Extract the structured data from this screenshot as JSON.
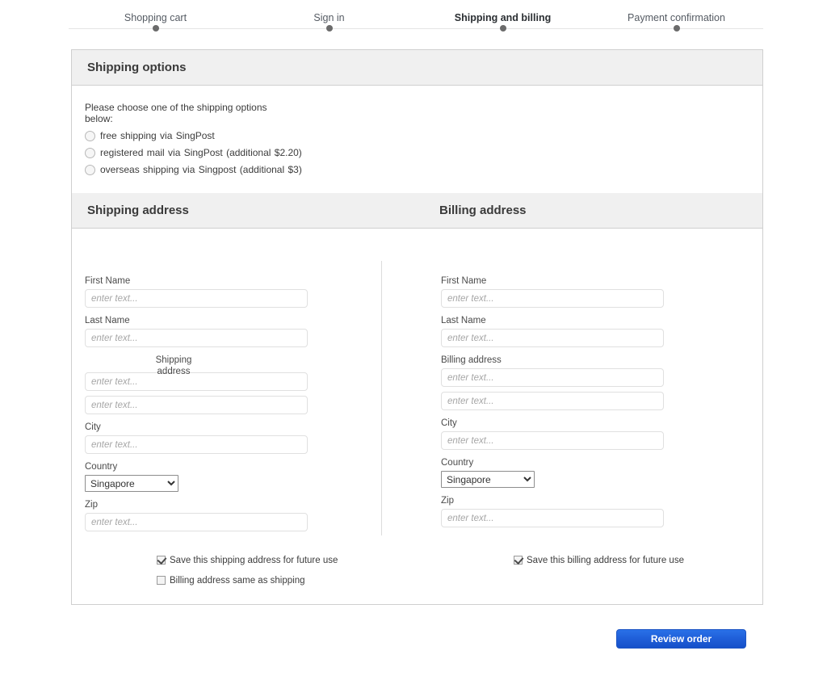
{
  "steps": {
    "items": [
      {
        "label": "Shopping cart",
        "active": false
      },
      {
        "label": "Sign in",
        "active": false
      },
      {
        "label": "Shipping and billing",
        "active": true
      },
      {
        "label": "Payment confirmation",
        "active": false
      }
    ]
  },
  "shipping_options": {
    "header": "Shipping options",
    "intro": "Please choose one of the shipping options below:",
    "options": [
      {
        "label": "free shipping via SingPost",
        "selected": false
      },
      {
        "label": "registered mail via SingPost (additional $2.20)",
        "selected": false
      },
      {
        "label": "overseas shipping via Singpost (additional $3)",
        "selected": false
      }
    ]
  },
  "address_section": {
    "shipping_header": "Shipping address",
    "billing_header": "Billing address",
    "placeholder": "enter text...",
    "shipping": {
      "first_name_label": "First Name",
      "first_name_value": "",
      "last_name_label": "Last Name",
      "last_name_value": "",
      "address_label": "Shipping\naddress",
      "address_line1_value": "",
      "address_line2_value": "",
      "city_label": "City",
      "city_value": "",
      "country_label": "Country",
      "country_value": "Singapore",
      "zip_label": "Zip",
      "zip_value": "",
      "save_checkbox_label": "Save this shipping address for future use",
      "save_checkbox_checked": true,
      "same_as_shipping_label": "Billing address same as shipping",
      "same_as_shipping_checked": false
    },
    "billing": {
      "first_name_label": "First Name",
      "first_name_value": "",
      "last_name_label": "Last Name",
      "last_name_value": "",
      "address_label": "Billing address",
      "address_line1_value": "",
      "address_line2_value": "",
      "city_label": "City",
      "city_value": "",
      "country_label": "Country",
      "country_value": "Singapore",
      "zip_label": "Zip",
      "zip_value": "",
      "save_checkbox_label": "Save this billing address for future use",
      "save_checkbox_checked": true
    }
  },
  "footer": {
    "review_order_label": "Review order"
  },
  "colors": {
    "primary_button": "#1f5ed8",
    "panel_header_bg": "#f0f0f0",
    "panel_border": "#cfcfcf",
    "step_dot": "#6b6b6b"
  }
}
